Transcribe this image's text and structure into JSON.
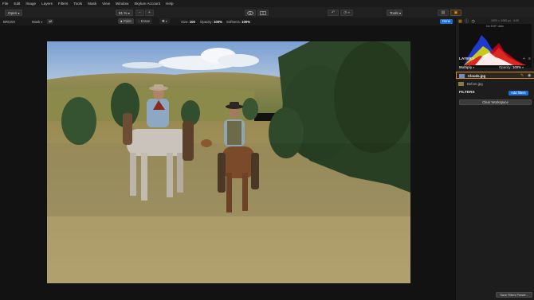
{
  "menu": [
    "File",
    "Edit",
    "Image",
    "Layers",
    "Filters",
    "Tools",
    "Mask",
    "View",
    "Window",
    "Skylum Account",
    "Help"
  ],
  "toolbar": {
    "open_label": "Open",
    "zoom": "61 %",
    "zoom_out": "−",
    "zoom_in": "+",
    "tools_label": "Tools",
    "eye_icon": "eye-icon",
    "compare_icon": "compare-icon",
    "undo_icon": "undo-icon",
    "history_icon": "history-icon",
    "layout_icon": "layout-icon",
    "filters_icon": "filters-panel-icon"
  },
  "options": {
    "tool": "BRUSH",
    "mask_label": "Mask",
    "paint_label": "Paint",
    "erase_label": "Erase",
    "size_label": "Size:",
    "size_value": "100",
    "opacity_label": "Opacity:",
    "opacity_value": "100%",
    "softness_label": "Softness:",
    "softness_value": "100%",
    "done_label": "Done"
  },
  "panel": {
    "dims": "1920 × 1280 px · 4.00",
    "no_exif": "No EXIF data",
    "layers_title": "LAYERS",
    "blend_mode": "Multiply",
    "opacity_label": "Opacity:",
    "opacity_value": "100%",
    "layers": [
      {
        "name": "Clouds.jpg",
        "active": true
      },
      {
        "name": "Before.jpg",
        "active": false
      }
    ],
    "filters_title": "FILTERS",
    "add_filters": "Add filters",
    "clear_workspace": "Clear Workspace",
    "save_preset": "Save Filters Preset..."
  },
  "colors": {
    "accent": "#1f6fd1",
    "active_layer": "#e08a1e",
    "bg": "#141414"
  }
}
